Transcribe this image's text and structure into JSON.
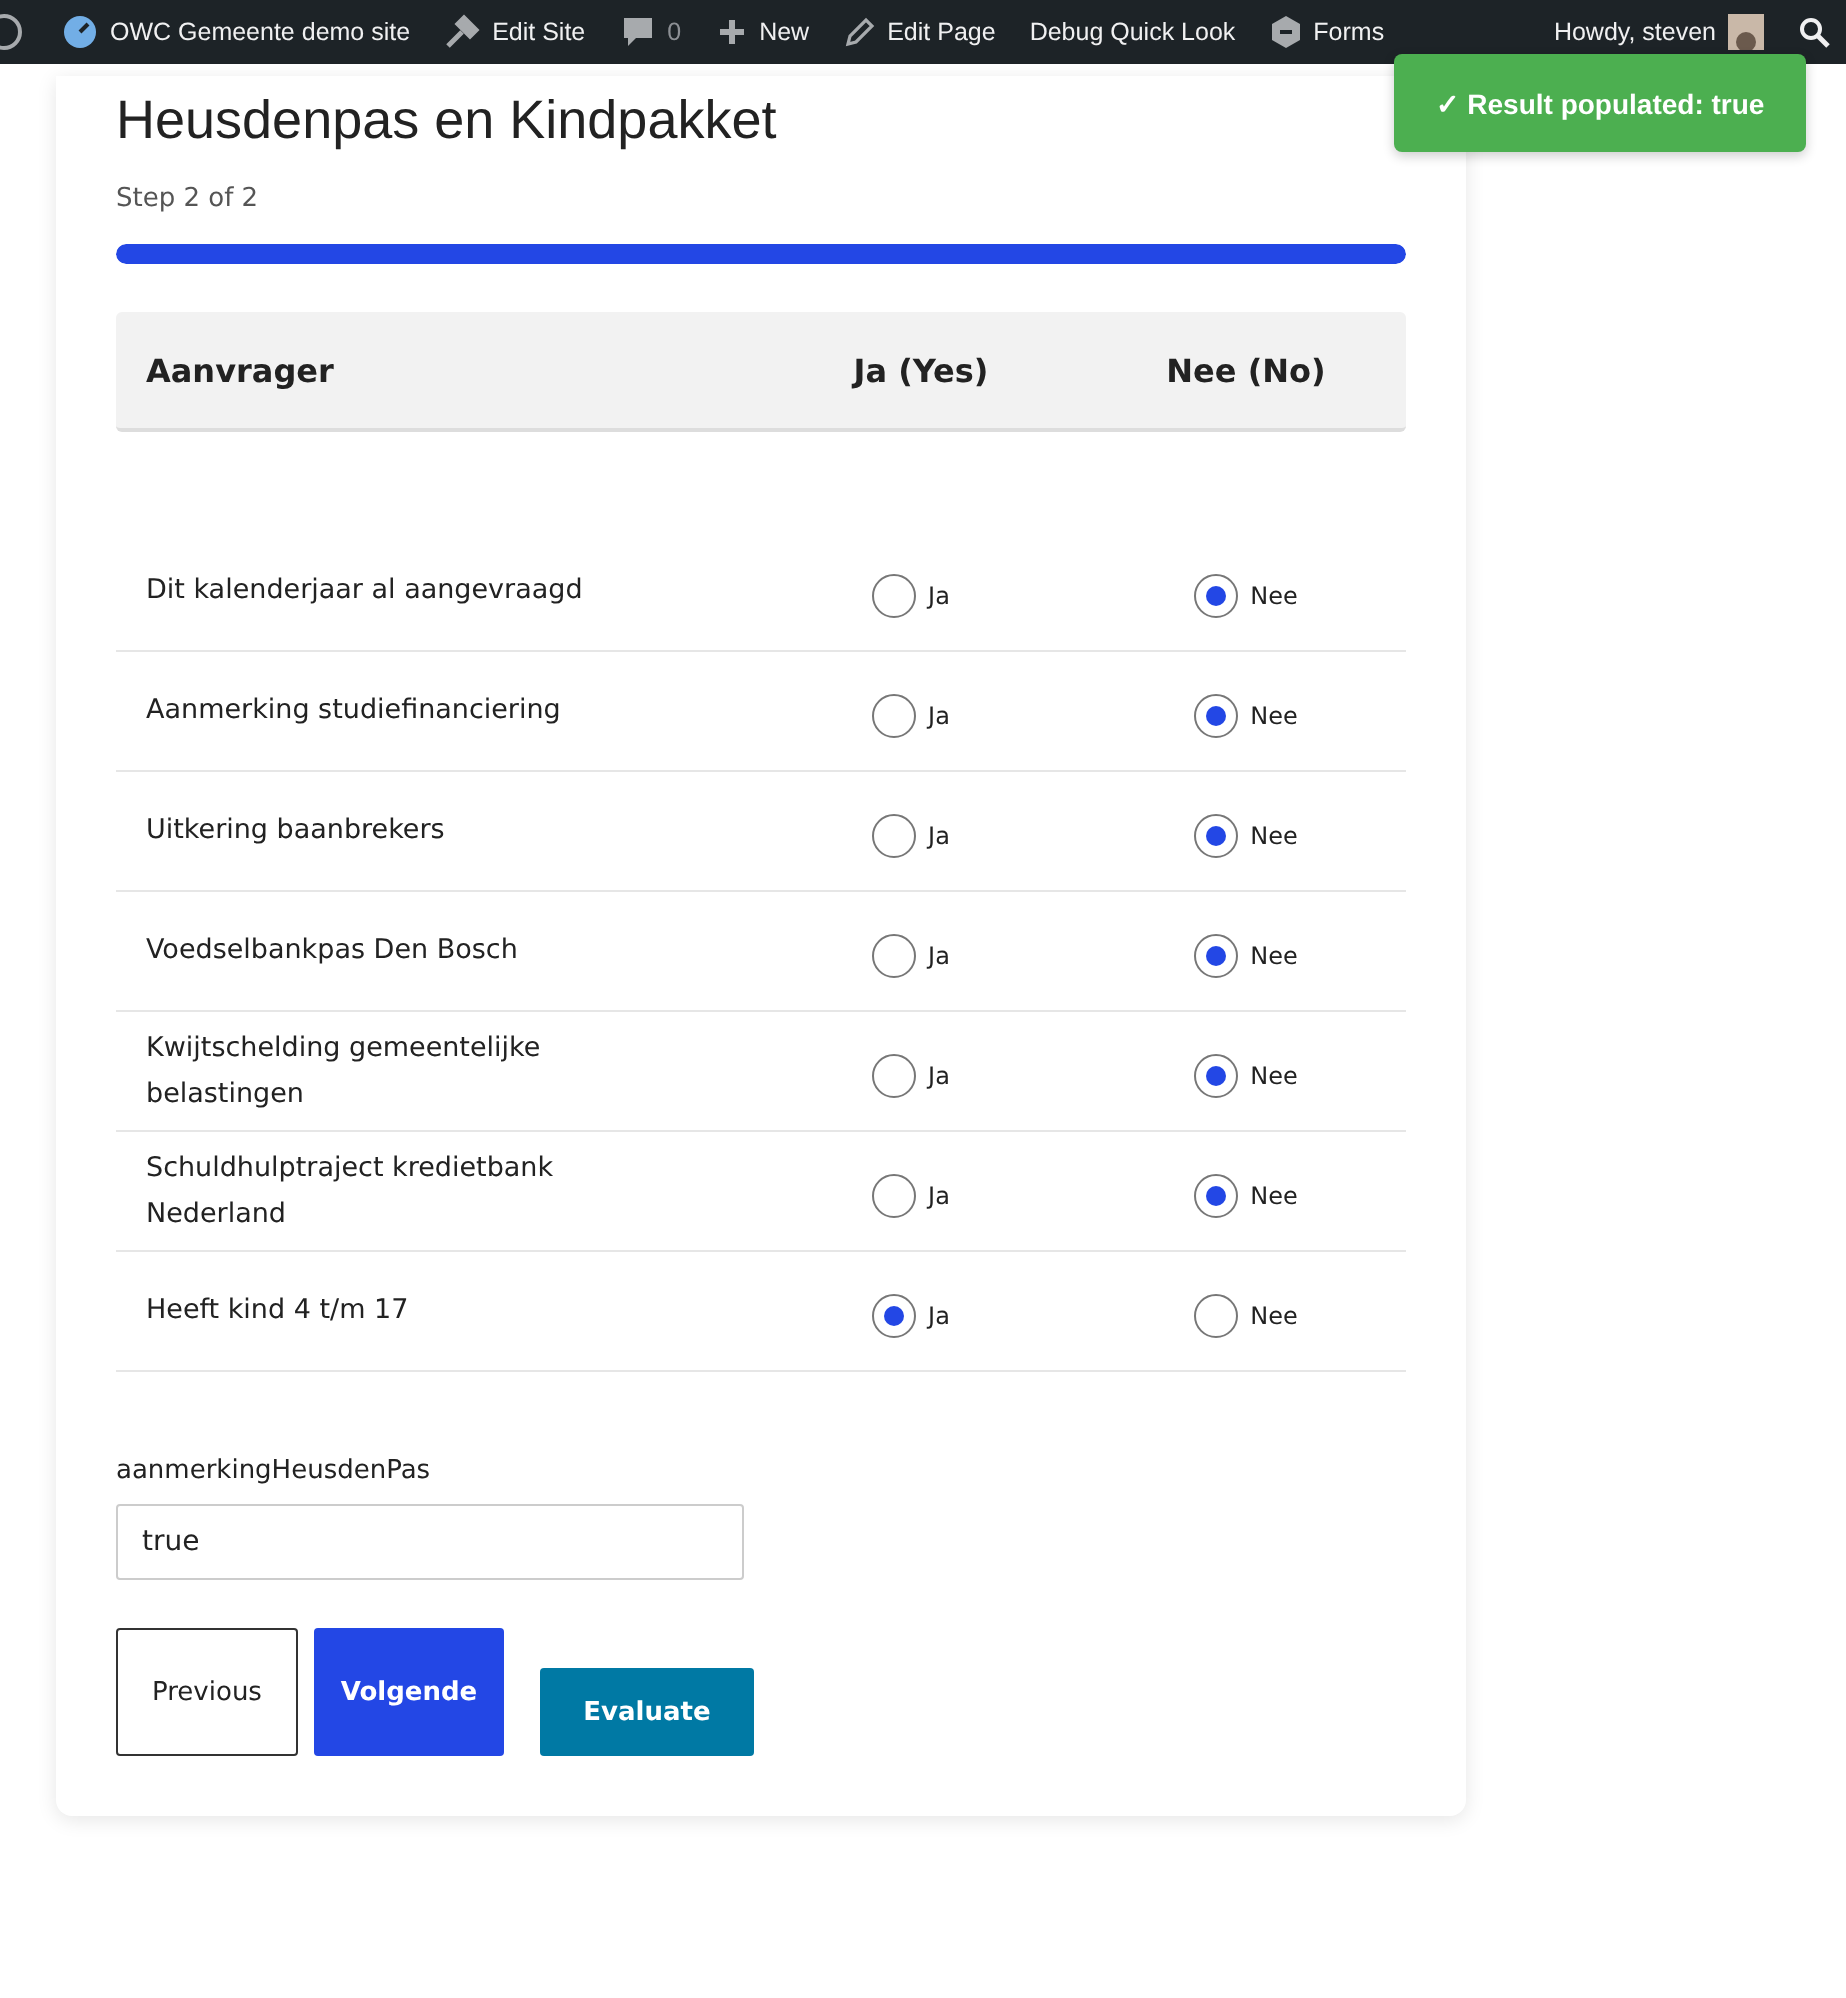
{
  "admin_bar": {
    "items": [
      {
        "kind": "logo"
      },
      {
        "kind": "site",
        "label": "OWC Gemeente demo site"
      },
      {
        "kind": "edit",
        "label": "Edit Site"
      },
      {
        "kind": "comments",
        "label": "0"
      },
      {
        "kind": "new",
        "label": "New"
      },
      {
        "kind": "pencil",
        "label": "Edit Page"
      },
      {
        "kind": "text",
        "label": "Debug Quick Look"
      },
      {
        "kind": "forms",
        "label": "Forms"
      }
    ],
    "account": "Howdy, steven"
  },
  "toast": {
    "text": "✓ Result populated: true"
  },
  "form": {
    "title": "Heusdenpas en Kindpakket",
    "step": "Step 2 of 2",
    "level": 1,
    "columns": [
      "Aanvrager",
      "Ja (Yes)",
      "Nee (No)"
    ],
    "rows": [
      {
        "label": "Dit kalenderjaar al aangevraagd",
        "options": [
          {
            "label": "Ja",
            "selected": false
          },
          {
            "label": "Nee",
            "selected": true
          }
        ]
      },
      {
        "label": "Aanmerking studiefinanciering",
        "options": [
          {
            "label": "Ja",
            "selected": false
          },
          {
            "label": "Nee",
            "selected": true
          }
        ]
      },
      {
        "label": "Uitkering baanbrekers",
        "options": [
          {
            "label": "Ja",
            "selected": false
          },
          {
            "label": "Nee",
            "selected": true
          }
        ]
      },
      {
        "label": "Voedselbankpas Den Bosch",
        "options": [
          {
            "label": "Ja",
            "selected": false
          },
          {
            "label": "Nee",
            "selected": true
          }
        ]
      },
      {
        "label": "Kwijtschelding gemeentelijke belastingen",
        "options": [
          {
            "label": "Ja",
            "selected": false
          },
          {
            "label": "Nee",
            "selected": true
          }
        ]
      },
      {
        "label": "Schuldhulptraject kredietbank Nederland",
        "options": [
          {
            "label": "Ja",
            "selected": false
          },
          {
            "label": "Nee",
            "selected": true
          }
        ]
      },
      {
        "label": "Heeft kind 4 t/m 17",
        "options": [
          {
            "label": "Ja",
            "selected": true
          },
          {
            "label": "Nee",
            "selected": false
          }
        ]
      }
    ],
    "field": {
      "label": "aanmerkingHeusdenPas",
      "value": "true"
    },
    "buttons": [
      {
        "kind": "secondary",
        "label": "Previous"
      },
      {
        "kind": "primary",
        "label": "Volgende"
      },
      {
        "kind": "evaluate",
        "label": "Evaluate"
      }
    ]
  }
}
